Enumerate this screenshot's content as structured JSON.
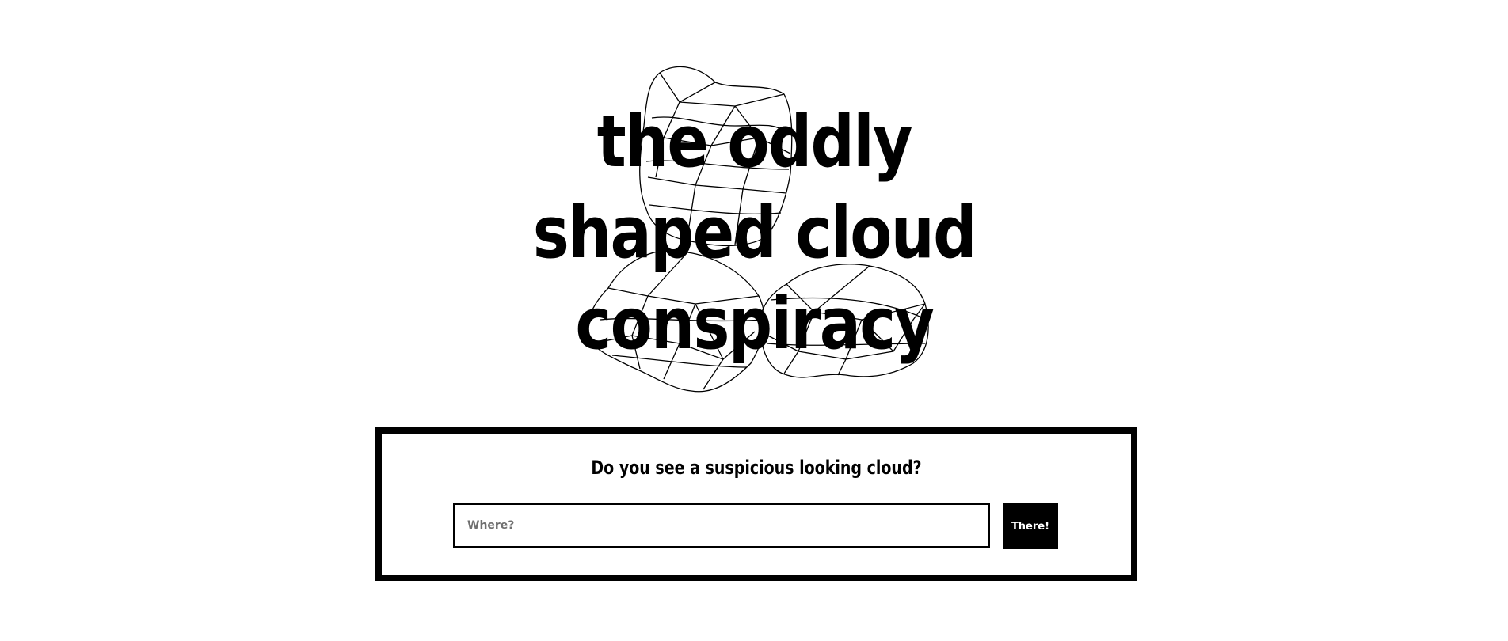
{
  "site": {
    "title_lines": [
      "the oddly",
      "shaped cloud",
      "conspiracy"
    ],
    "logo_icon": "wireframe-cloud-icon"
  },
  "report": {
    "question": "Do you see a suspicious looking cloud?",
    "input_placeholder": "Where?",
    "input_value": "",
    "submit_label": "There!"
  },
  "colors": {
    "background": "#ffffff",
    "foreground": "#000000",
    "placeholder": "#6f6f6f",
    "button_text": "#ffffff"
  }
}
